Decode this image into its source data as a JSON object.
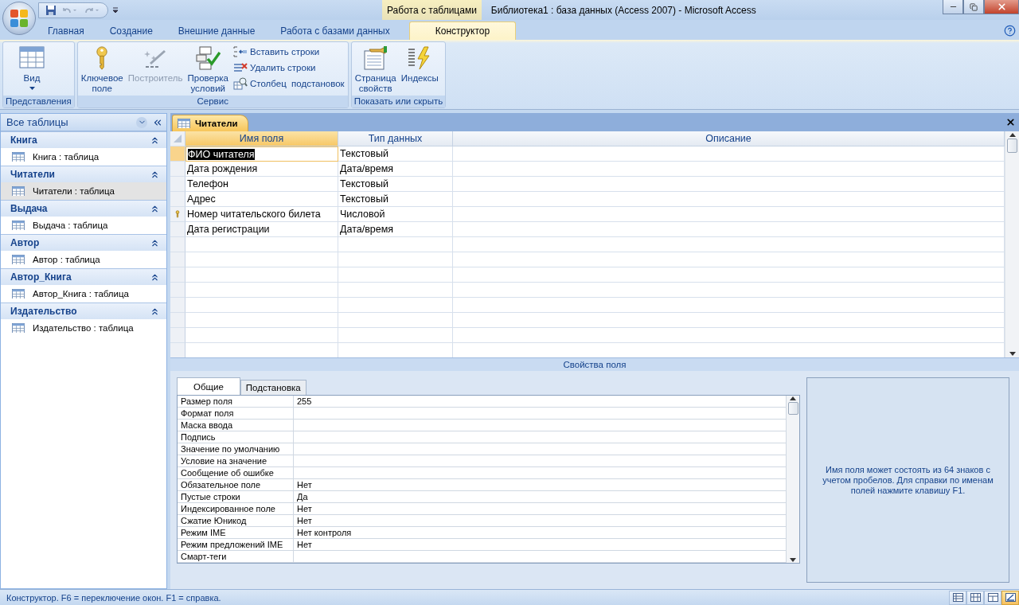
{
  "window": {
    "context_label": "Работа с таблицами",
    "title": "Библиотека1 : база данных (Access 2007)  -  Microsoft Access"
  },
  "ribbon_tabs": [
    {
      "label": "Главная",
      "selected": false
    },
    {
      "label": "Создание",
      "selected": false
    },
    {
      "label": "Внешние данные",
      "selected": false
    },
    {
      "label": "Работа с базами данных",
      "selected": false
    },
    {
      "label": "Конструктор",
      "selected": true
    }
  ],
  "ribbon_groups": [
    {
      "label": "Представления",
      "buttons": [
        {
          "label": "Вид",
          "kind": "dropdown",
          "disabled": false
        }
      ]
    },
    {
      "label": "Сервис",
      "buttons": [
        {
          "label": "Ключевое поле",
          "kind": "large",
          "disabled": false
        },
        {
          "label": "Построитель",
          "kind": "large",
          "disabled": true
        },
        {
          "label": "Проверка условий",
          "kind": "large",
          "disabled": false
        },
        {
          "label": "Вставить строки",
          "kind": "small",
          "disabled": false
        },
        {
          "label": "Удалить строки",
          "kind": "small",
          "disabled": false
        },
        {
          "label": "Столбец  подстановок",
          "kind": "small",
          "disabled": false
        }
      ]
    },
    {
      "label": "Показать или скрыть",
      "buttons": [
        {
          "label": "Страница свойств",
          "kind": "large",
          "disabled": false
        },
        {
          "label": "Индексы",
          "kind": "large",
          "disabled": false
        }
      ]
    }
  ],
  "nav_pane": {
    "title": "Все таблицы",
    "groups": [
      {
        "title": "Книга",
        "items": [
          {
            "label": "Книга : таблица",
            "selected": false
          }
        ]
      },
      {
        "title": "Читатели",
        "items": [
          {
            "label": "Читатели : таблица",
            "selected": true
          }
        ]
      },
      {
        "title": "Выдача",
        "items": [
          {
            "label": "Выдача : таблица",
            "selected": false
          }
        ]
      },
      {
        "title": "Автор",
        "items": [
          {
            "label": "Автор : таблица",
            "selected": false
          }
        ]
      },
      {
        "title": "Автор_Книга",
        "items": [
          {
            "label": "Автор_Книга : таблица",
            "selected": false
          }
        ]
      },
      {
        "title": "Издательство",
        "items": [
          {
            "label": "Издательство : таблица",
            "selected": false
          }
        ]
      }
    ]
  },
  "document_tab": {
    "label": "Читатели"
  },
  "design_grid": {
    "columns": [
      {
        "label": "Имя поля",
        "selected": true
      },
      {
        "label": "Тип данных",
        "selected": false
      },
      {
        "label": "Описание",
        "selected": false
      }
    ],
    "rows": [
      {
        "name": "ФИО читателя",
        "type": "Текстовый",
        "primary_key": false,
        "selected": true
      },
      {
        "name": "Дата рождения",
        "type": "Дата/время",
        "primary_key": false,
        "selected": false
      },
      {
        "name": "Телефон",
        "type": "Текстовый",
        "primary_key": false,
        "selected": false
      },
      {
        "name": "Адрес",
        "type": "Текстовый",
        "primary_key": false,
        "selected": false
      },
      {
        "name": "Номер  читательского билета",
        "type": "Числовой",
        "primary_key": true,
        "selected": false
      },
      {
        "name": "Дата регистрации",
        "type": "Дата/время",
        "primary_key": false,
        "selected": false
      }
    ]
  },
  "field_properties": {
    "title": "Свойства поля",
    "tabs": [
      {
        "label": "Общие",
        "selected": true
      },
      {
        "label": "Подстановка",
        "selected": false
      }
    ],
    "rows": [
      {
        "label": "Размер поля",
        "value": "255"
      },
      {
        "label": "Формат поля"
      },
      {
        "label": "Маска ввода"
      },
      {
        "label": "Подпись"
      },
      {
        "label": "Значение по умолчанию"
      },
      {
        "label": "Условие на значение"
      },
      {
        "label": "Сообщение об ошибке"
      },
      {
        "label": "Обязательное поле",
        "value": "Нет"
      },
      {
        "label": "Пустые строки",
        "value": "Да"
      },
      {
        "label": "Индексированное поле",
        "value": "Нет"
      },
      {
        "label": "Сжатие Юникод",
        "value": "Нет"
      },
      {
        "label": "Режим IME",
        "value": "Нет контроля"
      },
      {
        "label": "Режим предложений IME",
        "value": "Нет"
      },
      {
        "label": "Смарт-теги"
      }
    ],
    "help": "Имя поля может состоять из 64 знаков с учетом пробелов.  Для справки по именам полей нажмите клавишу F1."
  },
  "status_bar": {
    "text": "Конструктор.  F6 = переключение окон.  F1 = справка.",
    "view_buttons": [
      {
        "selected": false
      },
      {
        "selected": false
      },
      {
        "selected": false
      },
      {
        "selected": true
      }
    ]
  }
}
